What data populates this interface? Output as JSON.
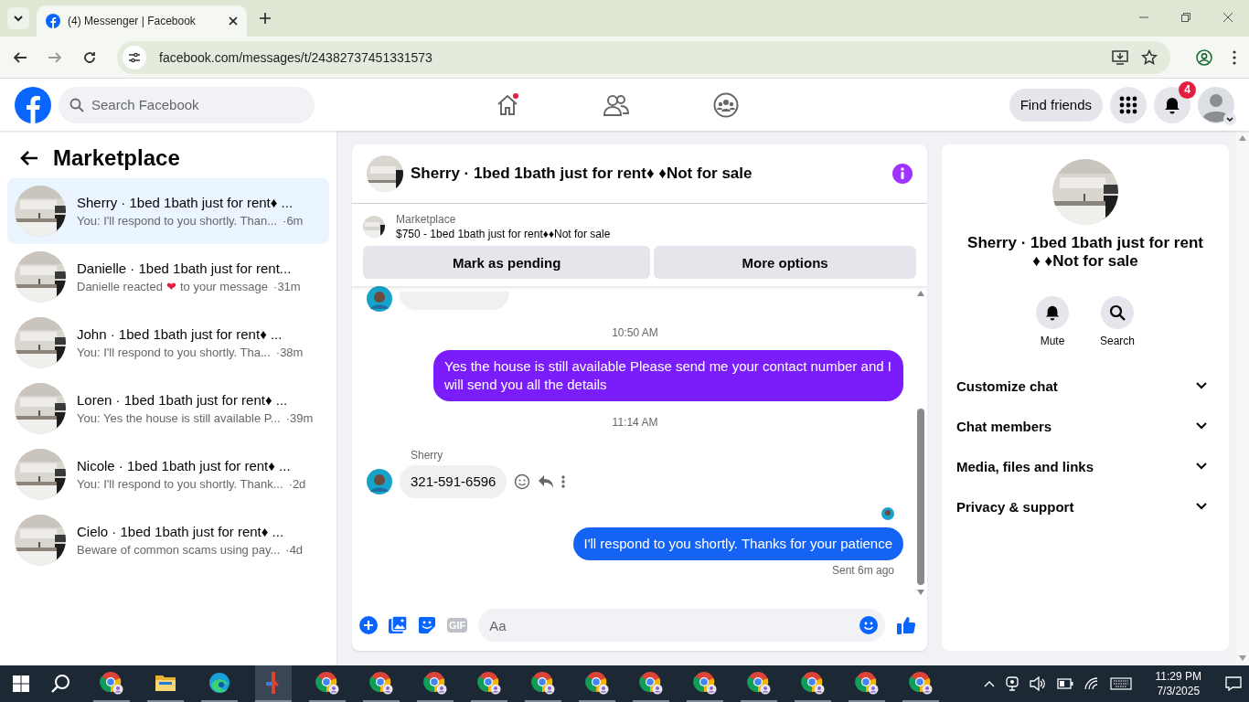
{
  "browser": {
    "tab_title": "(4) Messenger | Facebook",
    "url": "facebook.com/messages/t/24382737451331573"
  },
  "topbar": {
    "search_placeholder": "Search Facebook",
    "find_friends": "Find friends",
    "notification_count": "4"
  },
  "sidebar": {
    "title": "Marketplace",
    "items": [
      {
        "name": "Sherry · 1bed 1bath just for rent♦ ...",
        "preview": "You: I'll respond to you shortly. Than...",
        "time": "·6m",
        "selected": true
      },
      {
        "name": "Danielle · 1bed 1bath just for rent...",
        "preview": "Danielle reacted",
        "reaction": "❤",
        "preview_end": "to your message",
        "time": "·31m",
        "selected": false
      },
      {
        "name": "John · 1bed 1bath just for rent♦ ...",
        "preview": "You: I'll respond to you shortly. Tha...",
        "time": "·38m",
        "selected": false
      },
      {
        "name": "Loren · 1bed 1bath just for rent♦ ...",
        "preview": "You: Yes the house is still available P...",
        "time": "·39m",
        "selected": false
      },
      {
        "name": "Nicole · 1bed 1bath just for rent♦ ...",
        "preview": "You: I'll respond to you shortly. Thank...",
        "time": "·2d",
        "selected": false
      },
      {
        "name": "Cielo · 1bed 1bath just for rent♦ ...",
        "preview": "Beware of common scams using pay...",
        "time": "·4d",
        "selected": false
      }
    ]
  },
  "chat": {
    "title": "Sherry · 1bed 1bath just for rent♦ ♦Not for sale",
    "listing_label": "Marketplace",
    "listing_title": "$750 - 1bed 1bath just for rent♦♦Not for sale",
    "buttons": [
      "Mark as pending",
      "More options"
    ],
    "messages": [
      {
        "kind": "stub"
      },
      {
        "kind": "time",
        "text": "10:50 AM"
      },
      {
        "kind": "me",
        "text": "Yes the house is still available Please send me your contact number and I will send you all the details",
        "color": "#7b1dfb"
      },
      {
        "kind": "time",
        "text": "11:14 AM"
      },
      {
        "kind": "them",
        "sender": "Sherry",
        "text": "321-591-6596"
      },
      {
        "kind": "seen"
      },
      {
        "kind": "me",
        "text": "I'll respond to you shortly. Thanks for your patience",
        "color": "#1463f5"
      },
      {
        "kind": "status",
        "text": "Sent 6m ago"
      }
    ],
    "composer": {
      "gif": "GIF",
      "placeholder": "Aa"
    }
  },
  "details": {
    "name": "Sherry · 1bed 1bath just for rent ♦ ♦Not for sale",
    "actions": [
      {
        "kind": "mute",
        "label": "Mute"
      },
      {
        "kind": "search",
        "label": "Search"
      }
    ],
    "sections": [
      "Customize chat",
      "Chat members",
      "Media, files and links",
      "Privacy & support"
    ]
  },
  "taskbar": {
    "apps": [
      {
        "kind": "browser",
        "selected": false
      },
      {
        "kind": "folder",
        "selected": false
      },
      {
        "kind": "edge",
        "selected": false
      },
      {
        "kind": "tool",
        "selected": true
      },
      {
        "kind": "browser",
        "selected": false
      },
      {
        "kind": "browser",
        "selected": false
      },
      {
        "kind": "browser",
        "selected": false
      },
      {
        "kind": "browser",
        "selected": false
      },
      {
        "kind": "browser",
        "selected": false
      },
      {
        "kind": "browser",
        "selected": false
      },
      {
        "kind": "browser",
        "selected": false
      },
      {
        "kind": "browser",
        "selected": false
      },
      {
        "kind": "browser",
        "selected": false
      },
      {
        "kind": "browser",
        "selected": false
      },
      {
        "kind": "browser",
        "selected": false
      },
      {
        "kind": "browser",
        "selected": false
      }
    ],
    "time": "11:29 PM",
    "date": "7/3/2025"
  }
}
